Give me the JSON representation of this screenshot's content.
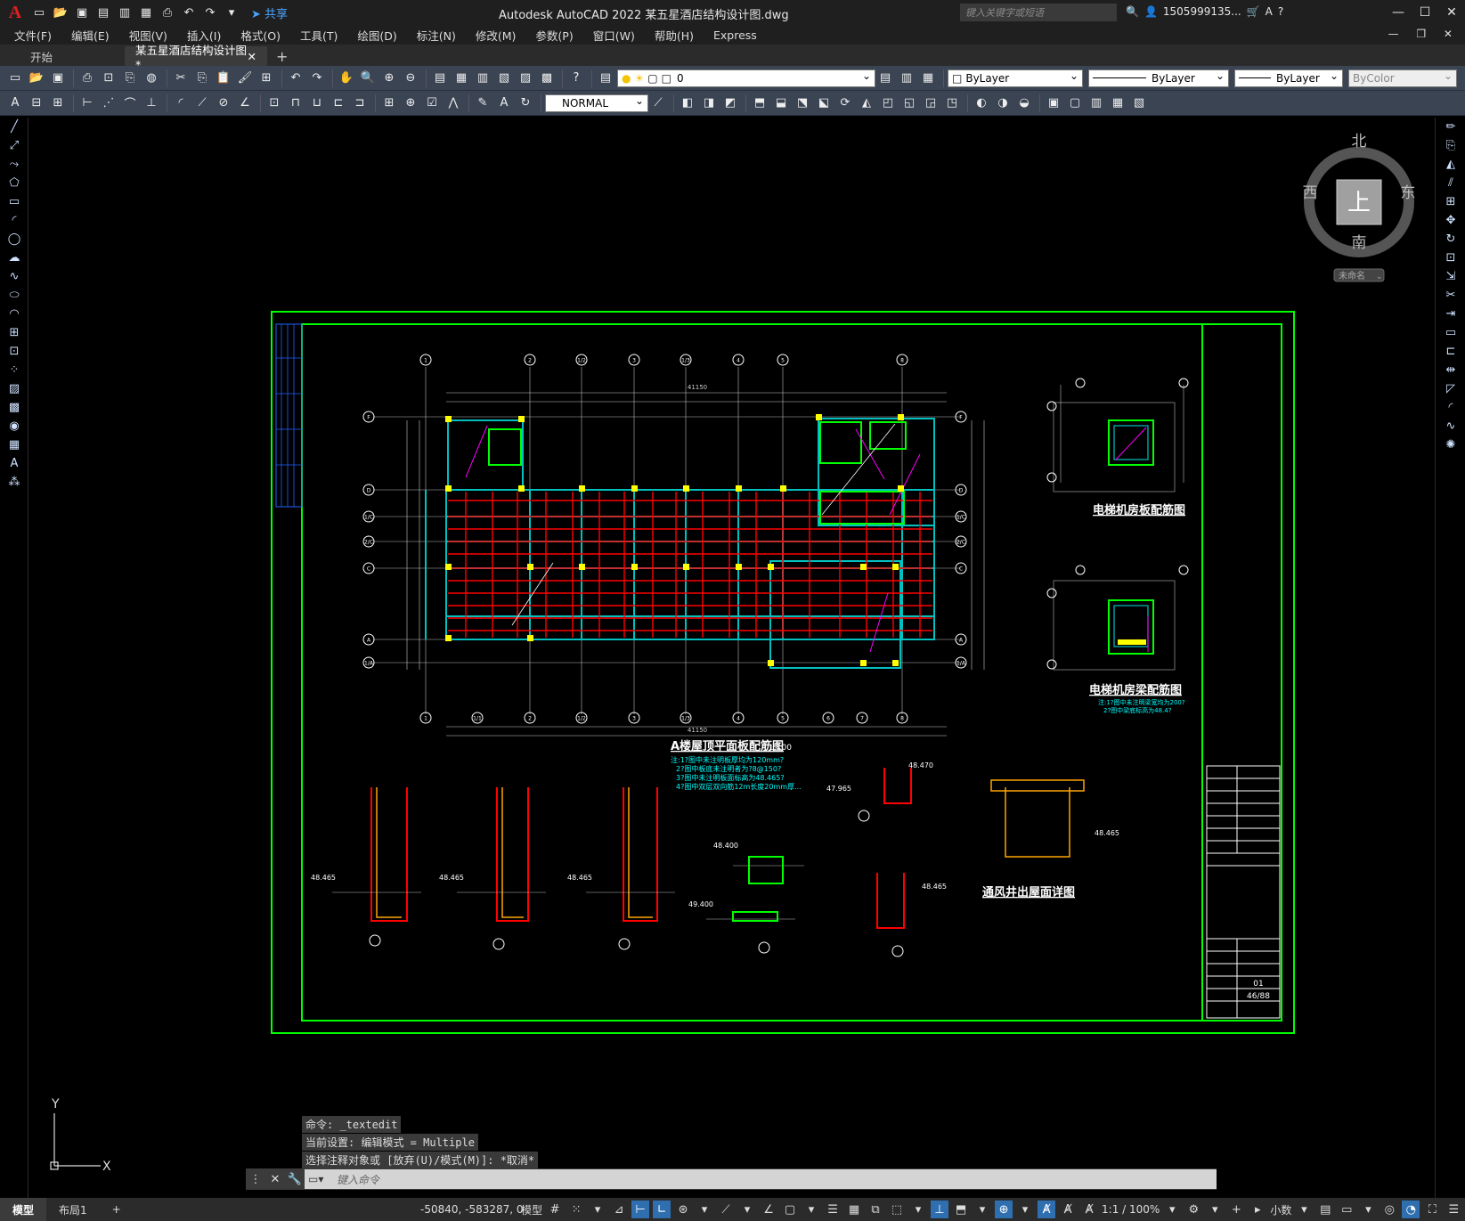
{
  "app": {
    "logo": "A",
    "title": "Autodesk AutoCAD 2022    某五星酒店结构设计图.dwg",
    "share_label": "共享",
    "search_placeholder": "键入关键字或短语",
    "account": "1505999135..."
  },
  "menu": [
    "文件(F)",
    "编辑(E)",
    "视图(V)",
    "插入(I)",
    "格式(O)",
    "工具(T)",
    "绘图(D)",
    "标注(N)",
    "修改(M)",
    "参数(P)",
    "窗口(W)",
    "帮助(H)",
    "Express"
  ],
  "tabs": {
    "start": "开始",
    "active": "某五星酒店结构设计图*",
    "plus": "+"
  },
  "toolbar": {
    "layer_value": "0",
    "color_value": "ByLayer",
    "linetype_value": "ByLayer",
    "lineweight_value": "ByLayer",
    "plotstyle_value": "ByColor",
    "textstyle_value": "NORMAL"
  },
  "viewcube": {
    "north": "北",
    "south": "南",
    "east": "东",
    "west": "西",
    "top": "上",
    "ucs_name": "未命名"
  },
  "drawing": {
    "main_title": "A楼屋顶平面板配筋图",
    "main_scale": "1:100",
    "elev_plan_title": "电梯机房板配筋图",
    "elev_beam_title": "电梯机房梁配筋图",
    "vent_title": "通风井出屋面详图",
    "grid_top": [
      "1",
      "2",
      "1/2",
      "3",
      "1/3",
      "4",
      "5",
      "8"
    ],
    "grid_bottom": [
      "1",
      "1/1",
      "2",
      "1/2",
      "3",
      "1/3",
      "4",
      "5",
      "6",
      "7",
      "8"
    ],
    "grid_left": [
      "F",
      "D",
      "1/C",
      "2/C",
      "C",
      "A",
      "1/A"
    ],
    "total_dim": "41150",
    "notes": [
      "注:1?图中未注明板厚均为120mm?",
      "2?图中板底未注明者为?8@150?",
      "3?图中未注明板面标高为48.465?",
      "4?图中双层双向筋12m长度20mm厚..."
    ],
    "elev_notes": [
      "注:1?图中未注明梁宽均为200?",
      "2?图中梁底标高为48.4?"
    ],
    "levels": [
      "48.470",
      "47.965",
      "48.400",
      "49.400",
      "48.465"
    ],
    "sheet_no": "46/88",
    "sheet_rev": "01"
  },
  "commands": {
    "line1": "命令: _textedit",
    "line2": "当前设置: 编辑模式 = Multiple",
    "line3": "选择注释对象或 [放弃(U)/模式(M)]: *取消*",
    "input_placeholder": "键入命令"
  },
  "status": {
    "layout_tabs": [
      "模型",
      "布局1"
    ],
    "coords": "-50840, -583287, 0",
    "model_label": "模型",
    "scale": "1:1 / 100%",
    "units": "小数"
  },
  "ucs": {
    "x": "X",
    "y": "Y"
  },
  "colors": {
    "green": "#00ff00",
    "cyan": "#00c0c0",
    "red": "#ff0000",
    "yellow": "#ffff00",
    "magenta": "#ff00ff",
    "white": "#ffffff"
  }
}
